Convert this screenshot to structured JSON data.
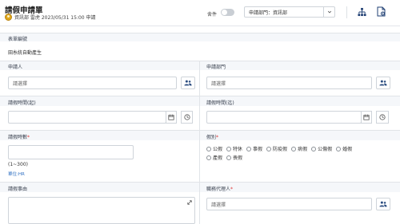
{
  "header": {
    "title": "請假申請單",
    "applicant_meta": "資訊部 雷虎 2023/05/31 15:00 申請",
    "kitchen_label": "舍件",
    "dept_select": "申請部門：資訊部"
  },
  "form": {
    "form_no_label": "表單編號",
    "form_no_value": "田糸統自動產生",
    "applicant_label": "申請人",
    "applicant_placeholder": "請選擇",
    "dept_label": "申請部門",
    "dept_placeholder": "請選擇",
    "start_label": "請假時間(起)",
    "end_label": "請假時間(迄)",
    "hours_label": "請假時數",
    "hours_hint": "(1~300)",
    "hours_unit": "單位:HR",
    "type_label": "假別",
    "leave_types": [
      "公假",
      "特休",
      "事假",
      "防疫假",
      "病假",
      "公傷假",
      "婚假",
      "產假",
      "喪假"
    ],
    "reason_label": "請假事由",
    "agent_label": "職務代理人",
    "agent_placeholder": "請選擇",
    "required_mark": "*"
  },
  "colors": {
    "required": "#dd3333",
    "link": "#2d6fc2",
    "avatar": "#e0a81e"
  }
}
